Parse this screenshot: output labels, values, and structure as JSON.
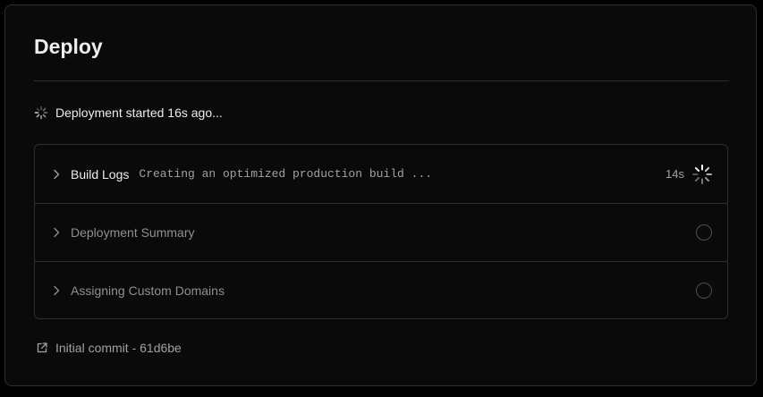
{
  "panel": {
    "title": "Deploy"
  },
  "status": {
    "text": "Deployment started 16s ago..."
  },
  "steps": [
    {
      "label": "Build Logs",
      "detail": "Creating an optimized production build ...",
      "duration": "14s",
      "state": "running"
    },
    {
      "label": "Deployment Summary",
      "state": "pending"
    },
    {
      "label": "Assigning Custom Domains",
      "state": "pending"
    }
  ],
  "commit": {
    "label": "Initial commit - 61d6be"
  },
  "colors": {
    "background": "#0a0a0a",
    "border": "#2e2e2e",
    "text_primary": "#ededed",
    "text_muted": "#8f8f8f"
  },
  "icons": {
    "status": "spinner-icon",
    "step_toggle": "chevron-right-icon",
    "running": "spinner-icon",
    "pending": "circle-icon",
    "commit": "external-link-icon"
  }
}
